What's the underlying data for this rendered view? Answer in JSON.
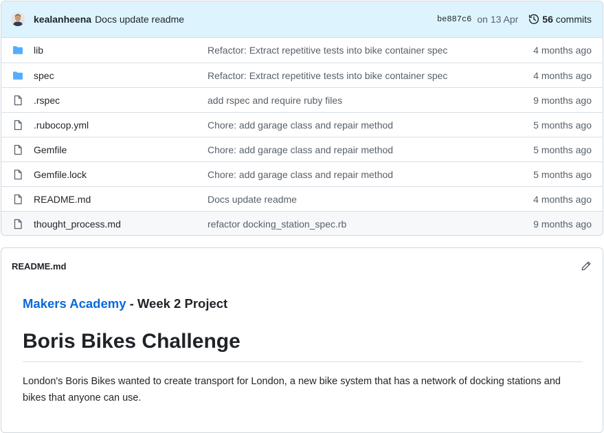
{
  "commit": {
    "author": "kealanheena",
    "message": "Docs update readme",
    "sha": "be887c6",
    "date": "on 13 Apr",
    "commit_count": "56",
    "commits_label": "commits"
  },
  "files": [
    {
      "name": "lib",
      "type": "folder",
      "commit": "Refactor: Extract repetitive tests into bike container spec",
      "age": "4 months ago"
    },
    {
      "name": "spec",
      "type": "folder",
      "commit": "Refactor: Extract repetitive tests into bike container spec",
      "age": "4 months ago"
    },
    {
      "name": ".rspec",
      "type": "file",
      "commit": "add rspec and require ruby files",
      "age": "9 months ago"
    },
    {
      "name": ".rubocop.yml",
      "type": "file",
      "commit": "Chore: add garage class and repair method",
      "age": "5 months ago"
    },
    {
      "name": "Gemfile",
      "type": "file",
      "commit": "Chore: add garage class and repair method",
      "age": "5 months ago"
    },
    {
      "name": "Gemfile.lock",
      "type": "file",
      "commit": "Chore: add garage class and repair method",
      "age": "5 months ago"
    },
    {
      "name": "README.md",
      "type": "file",
      "commit": "Docs update readme",
      "age": "4 months ago"
    },
    {
      "name": "thought_process.md",
      "type": "file",
      "commit": "refactor docking_station_spec.rb",
      "age": "9 months ago"
    }
  ],
  "readme": {
    "filename": "README.md",
    "subtitle_link": "Makers Academy",
    "subtitle_rest": " - Week 2 Project",
    "heading": "Boris Bikes Challenge",
    "paragraph": "London's Boris Bikes wanted to create transport for London, a new bike system that has a network of docking stations and bikes that anyone can use."
  },
  "colors": {
    "link": "#0969da",
    "folder_icon": "#54aeff",
    "header_bg": "#ddf4ff"
  }
}
